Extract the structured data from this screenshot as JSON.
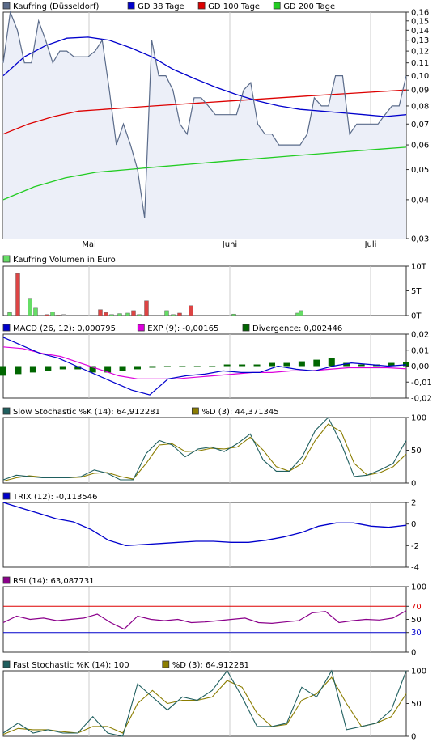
{
  "colors": {
    "price": "#5a6b8a",
    "price_fill": "#eceff8",
    "gd38": "#0000cc",
    "gd100": "#dd0000",
    "gd200": "#22cc22",
    "macd": "#0000cc",
    "exp": "#dd00dd",
    "divergence": "#006600",
    "stoch_k": "#1f5f5f",
    "stoch_d": "#8b7d00",
    "trix": "#0000cc",
    "rsi": "#8b008b",
    "rsi_hi": "#dd0000",
    "rsi_lo": "#0000cc",
    "vol_up": "#66dd66",
    "vol_down": "#dd4444",
    "vol_neutral": "#bbbbbb"
  },
  "x_axis": {
    "months": [
      "Mai",
      "Juni",
      "Juli"
    ]
  },
  "panels": {
    "price": {
      "legend": [
        {
          "label": "Kaufring (Düsseldorf)",
          "swatch": "price"
        },
        {
          "label": "GD 38 Tage",
          "swatch": "gd38"
        },
        {
          "label": "GD 100 Tage",
          "swatch": "gd100"
        },
        {
          "label": "GD 200 Tage",
          "swatch": "gd200"
        }
      ],
      "ticks": [
        "0,16",
        "0,15",
        "0,14",
        "0,13",
        "0,12",
        "0,11",
        "0,10",
        "0,09",
        "0,08",
        "0,07",
        "0,06",
        "0,05",
        "0,04",
        "0,03"
      ]
    },
    "volume": {
      "legend": [
        {
          "label": "Kaufring Volumen in Euro",
          "swatch": "vol_up"
        }
      ],
      "ticks": [
        "10T",
        "5T",
        "0T"
      ]
    },
    "macd": {
      "legend": [
        {
          "label": "MACD (26, 12): 0,000795",
          "swatch": "macd"
        },
        {
          "label": "EXP (9): -0,00165",
          "swatch": "exp"
        },
        {
          "label": "Divergence: 0,002446",
          "swatch": "divergence"
        }
      ],
      "ticks": [
        "0,02",
        "0,01",
        "0,00",
        "-0,01",
        "-0,02"
      ]
    },
    "slowsto": {
      "legend": [
        {
          "label": "Slow Stochastic %K (14): 64,912281",
          "swatch": "stoch_k"
        },
        {
          "label": "%D (3): 44,371345",
          "swatch": "stoch_d"
        }
      ],
      "ticks": [
        "100",
        "50",
        "0"
      ]
    },
    "trix": {
      "legend": [
        {
          "label": "TRIX (12): -0,113546",
          "swatch": "trix"
        }
      ],
      "ticks": [
        "2",
        "0",
        "-2",
        "-4"
      ]
    },
    "rsi": {
      "legend": [
        {
          "label": "RSI (14): 63,087731",
          "swatch": "rsi"
        }
      ],
      "ticks": [
        "100",
        "70",
        "50",
        "30",
        "0"
      ]
    },
    "faststo": {
      "legend": [
        {
          "label": "Fast Stochastic %K (14): 100",
          "swatch": "stoch_k"
        },
        {
          "label": "%D (3): 64,912281",
          "swatch": "stoch_d"
        }
      ],
      "ticks": [
        "100",
        "50",
        "0"
      ]
    }
  },
  "chart_data": {
    "type": "line",
    "x_labels": [
      "Mai",
      "Juni",
      "Juli"
    ],
    "series": [
      {
        "name": "Kaufring (Düsseldorf)",
        "values": [
          0.11,
          0.16,
          0.14,
          0.11,
          0.11,
          0.15,
          0.13,
          0.11,
          0.12,
          0.12,
          0.115,
          0.115,
          0.115,
          0.12,
          0.13,
          0.09,
          0.06,
          0.07,
          0.06,
          0.05,
          0.035,
          0.13,
          0.1,
          0.1,
          0.09,
          0.07,
          0.065,
          0.085,
          0.085,
          0.08,
          0.075,
          0.075,
          0.075,
          0.075,
          0.09,
          0.095,
          0.07,
          0.065,
          0.065,
          0.06,
          0.06,
          0.06,
          0.06,
          0.065,
          0.085,
          0.08,
          0.08,
          0.1,
          0.1,
          0.065,
          0.07,
          0.07,
          0.07,
          0.07,
          0.075,
          0.08,
          0.08,
          0.1
        ]
      },
      {
        "name": "GD 38 Tage",
        "values": [
          0.1,
          0.115,
          0.125,
          0.132,
          0.133,
          0.13,
          0.123,
          0.115,
          0.105,
          0.098,
          0.092,
          0.087,
          0.083,
          0.08,
          0.078,
          0.077,
          0.076,
          0.075,
          0.074,
          0.075
        ]
      },
      {
        "name": "GD 100 Tage",
        "values": [
          0.065,
          0.07,
          0.074,
          0.077,
          0.078,
          0.079,
          0.08,
          0.081,
          0.082,
          0.083,
          0.084,
          0.085,
          0.086,
          0.087,
          0.088,
          0.089,
          0.09
        ]
      },
      {
        "name": "GD 200 Tage",
        "values": [
          0.04,
          0.044,
          0.047,
          0.049,
          0.05,
          0.051,
          0.052,
          0.053,
          0.054,
          0.055,
          0.056,
          0.057,
          0.058,
          0.059
        ]
      },
      {
        "name": "Kaufring Volumen in Euro",
        "values": [
          0.6,
          8.5,
          3.5,
          1.5,
          0.2,
          0.7,
          0.1,
          0.2,
          1.2,
          0.6,
          0.2,
          0.4,
          0.5,
          1.0,
          0.2,
          3.0,
          1.0,
          0.2,
          0.5,
          2.0,
          0.3,
          0.5,
          1.0
        ]
      },
      {
        "name": "MACD (26, 12)",
        "values": [
          0.018,
          0.013,
          0.008,
          0.005,
          0.0,
          -0.005,
          -0.01,
          -0.015,
          -0.018,
          -0.008,
          -0.006,
          -0.005,
          -0.003,
          -0.004,
          -0.004,
          0.0,
          -0.002,
          -0.003,
          0.0,
          0.002,
          0.001,
          0.0,
          0.000795
        ]
      },
      {
        "name": "EXP (9)",
        "values": [
          0.012,
          0.011,
          0.008,
          0.006,
          0.002,
          -0.002,
          -0.006,
          -0.008,
          -0.008,
          -0.008,
          -0.007,
          -0.006,
          -0.005,
          -0.004,
          -0.004,
          -0.003,
          -0.003,
          -0.002,
          -0.001,
          -0.001,
          -0.001,
          -0.00165
        ]
      },
      {
        "name": "Divergence",
        "values": [
          -0.006,
          -0.005,
          -0.004,
          -0.003,
          -0.002,
          -0.002,
          -0.004,
          -0.004,
          -0.003,
          -0.002,
          -0.001,
          0.0,
          0.0,
          0.0,
          0.0,
          0.001,
          0.001,
          0.001,
          0.002,
          0.002,
          0.003,
          0.004,
          0.005,
          0.002,
          0.001,
          0.001,
          0.002,
          0.002446
        ]
      },
      {
        "name": "Slow Stochastic %K (14)",
        "values": [
          5,
          12,
          10,
          8,
          8,
          8,
          10,
          20,
          15,
          5,
          5,
          45,
          65,
          58,
          40,
          52,
          55,
          48,
          60,
          75,
          35,
          18,
          18,
          40,
          80,
          100,
          60,
          10,
          12,
          20,
          30,
          64.912281
        ]
      },
      {
        "name": "Slow Stochastic %D (3)",
        "values": [
          3,
          8,
          11,
          9,
          8,
          8,
          9,
          15,
          16,
          10,
          6,
          30,
          58,
          60,
          48,
          49,
          53,
          52,
          55,
          70,
          50,
          25,
          18,
          30,
          65,
          90,
          78,
          30,
          12,
          16,
          25,
          44.371345
        ]
      },
      {
        "name": "TRIX (12)",
        "values": [
          2,
          1.5,
          1.0,
          0.5,
          0.2,
          -0.5,
          -1.5,
          -2.0,
          -1.9,
          -1.8,
          -1.7,
          -1.6,
          -1.6,
          -1.7,
          -1.7,
          -1.5,
          -1.2,
          -0.8,
          -0.2,
          0.1,
          0.1,
          -0.2,
          -0.3,
          -0.113546
        ]
      },
      {
        "name": "RSI (14)",
        "values": [
          45,
          55,
          50,
          52,
          48,
          50,
          52,
          58,
          45,
          35,
          55,
          50,
          48,
          50,
          45,
          46,
          48,
          50,
          52,
          45,
          44,
          46,
          48,
          60,
          62,
          45,
          48,
          50,
          49,
          52,
          63.087731
        ]
      },
      {
        "name": "Fast Stochastic %K (14)",
        "values": [
          5,
          20,
          5,
          10,
          5,
          5,
          30,
          5,
          0,
          80,
          60,
          40,
          60,
          55,
          70,
          100,
          60,
          15,
          15,
          20,
          75,
          60,
          100,
          10,
          15,
          20,
          40,
          100
        ]
      },
      {
        "name": "Fast Stochastic %D (3)",
        "values": [
          3,
          12,
          10,
          10,
          7,
          5,
          15,
          15,
          5,
          50,
          70,
          50,
          55,
          55,
          60,
          85,
          75,
          35,
          15,
          18,
          55,
          65,
          90,
          50,
          15,
          20,
          30,
          64.912281
        ]
      }
    ]
  }
}
